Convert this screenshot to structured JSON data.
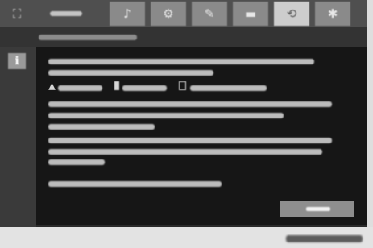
{
  "colors": {
    "header_bg": "#4f4f4f",
    "tab_bg": "#8a8a8a",
    "tab_active_bg": "#cdcdcd",
    "panel_bg": "#161616",
    "sidebar_bg": "#3a3a3a",
    "button_bg": "#8e8e8e",
    "footer_bg": "#e3e3e3"
  },
  "header": {
    "menu_icon": "fullscreen-icon",
    "menu_glyph": "⛶",
    "active_tab": 4,
    "tabs": [
      {
        "icon": "music-icon",
        "glyph": "♪"
      },
      {
        "icon": "settings-icon",
        "glyph": "⚙"
      },
      {
        "icon": "edit-icon",
        "glyph": "✎"
      },
      {
        "icon": "camera-icon",
        "glyph": "▬"
      },
      {
        "icon": "refresh-icon",
        "glyph": "⟲"
      },
      {
        "icon": "tools-icon",
        "glyph": "✱"
      }
    ]
  },
  "sidebar": {
    "info_icon": "info-icon",
    "info_glyph": "i"
  },
  "body": {
    "inline_icons": [
      "user-icon",
      "pin-icon",
      "box-icon"
    ]
  }
}
